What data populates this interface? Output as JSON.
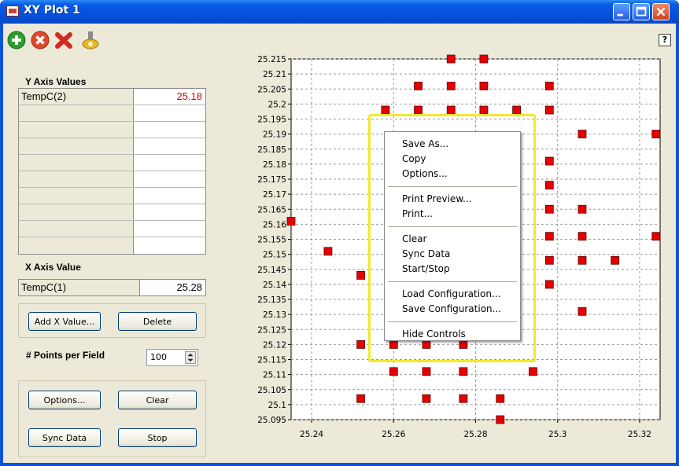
{
  "window": {
    "title": "XY Plot 1"
  },
  "toolbar": {
    "icons": [
      "add-icon",
      "remove-icon",
      "delete-icon",
      "properties-icon"
    ]
  },
  "y_axis": {
    "label": "Y Axis Values",
    "rows": [
      {
        "name": "TempC(2)",
        "value": "25.18"
      },
      {
        "name": "",
        "value": ""
      },
      {
        "name": "",
        "value": ""
      },
      {
        "name": "",
        "value": ""
      },
      {
        "name": "",
        "value": ""
      },
      {
        "name": "",
        "value": ""
      },
      {
        "name": "",
        "value": ""
      },
      {
        "name": "",
        "value": ""
      },
      {
        "name": "",
        "value": ""
      },
      {
        "name": "",
        "value": ""
      }
    ]
  },
  "x_axis": {
    "label": "X Axis Value",
    "name": "TempC(1)",
    "value": "25.28"
  },
  "buttons": {
    "add_x": "Add X Value...",
    "delete": "Delete",
    "options": "Options...",
    "clear": "Clear",
    "sync": "Sync Data",
    "stop": "Stop"
  },
  "points_per_field": {
    "label": "# Points per Field",
    "value": "100"
  },
  "help_label": "?",
  "context_menu": {
    "items": [
      [
        "Save As...",
        "Copy",
        "Options..."
      ],
      [
        "Print Preview...",
        "Print..."
      ],
      [
        "Clear",
        "Sync Data",
        "Start/Stop"
      ],
      [
        "Load Configuration...",
        "Save Configuration..."
      ],
      [
        "Hide Controls"
      ]
    ]
  },
  "colors": {
    "marker": "#e60000",
    "value_text": "#e00000",
    "title_bar": "#0a5ce6",
    "menu_highlight": "#f2e92e"
  },
  "chart_data": {
    "type": "scatter",
    "title": "",
    "xlabel": "",
    "ylabel": "",
    "xlim": [
      25.235,
      25.325
    ],
    "ylim": [
      25.095,
      25.215
    ],
    "x_ticks": [
      "25.24",
      "25.26",
      "25.28",
      "25.3",
      "25.32"
    ],
    "y_ticks": [
      "25.215",
      "25.21",
      "25.205",
      "25.2",
      "25.195",
      "25.19",
      "25.185",
      "25.18",
      "25.175",
      "25.17",
      "25.165",
      "25.16",
      "25.155",
      "25.15",
      "25.145",
      "25.14",
      "25.135",
      "25.13",
      "25.125",
      "25.12",
      "25.115",
      "25.11",
      "25.105",
      "25.1",
      "25.095"
    ],
    "grid": true,
    "series": [
      {
        "points": [
          [
            25.274,
            25.215
          ],
          [
            25.282,
            25.215
          ],
          [
            25.266,
            25.206
          ],
          [
            25.274,
            25.206
          ],
          [
            25.282,
            25.206
          ],
          [
            25.298,
            25.206
          ],
          [
            25.258,
            25.198
          ],
          [
            25.266,
            25.198
          ],
          [
            25.274,
            25.198
          ],
          [
            25.282,
            25.198
          ],
          [
            25.29,
            25.198
          ],
          [
            25.298,
            25.198
          ],
          [
            25.306,
            25.19
          ],
          [
            25.324,
            25.19
          ],
          [
            25.298,
            25.181
          ],
          [
            25.298,
            25.173
          ],
          [
            25.298,
            25.165
          ],
          [
            25.306,
            25.165
          ],
          [
            25.235,
            25.161
          ],
          [
            25.298,
            25.156
          ],
          [
            25.306,
            25.156
          ],
          [
            25.324,
            25.156
          ],
          [
            25.244,
            25.151
          ],
          [
            25.298,
            25.148
          ],
          [
            25.306,
            25.148
          ],
          [
            25.314,
            25.148
          ],
          [
            25.252,
            25.143
          ],
          [
            25.298,
            25.14
          ],
          [
            25.306,
            25.131
          ],
          [
            25.252,
            25.12
          ],
          [
            25.26,
            25.12
          ],
          [
            25.268,
            25.12
          ],
          [
            25.277,
            25.12
          ],
          [
            25.26,
            25.111
          ],
          [
            25.268,
            25.111
          ],
          [
            25.277,
            25.111
          ],
          [
            25.294,
            25.111
          ],
          [
            25.252,
            25.102
          ],
          [
            25.268,
            25.102
          ],
          [
            25.277,
            25.102
          ],
          [
            25.286,
            25.102
          ],
          [
            25.286,
            25.095
          ]
        ]
      }
    ]
  }
}
